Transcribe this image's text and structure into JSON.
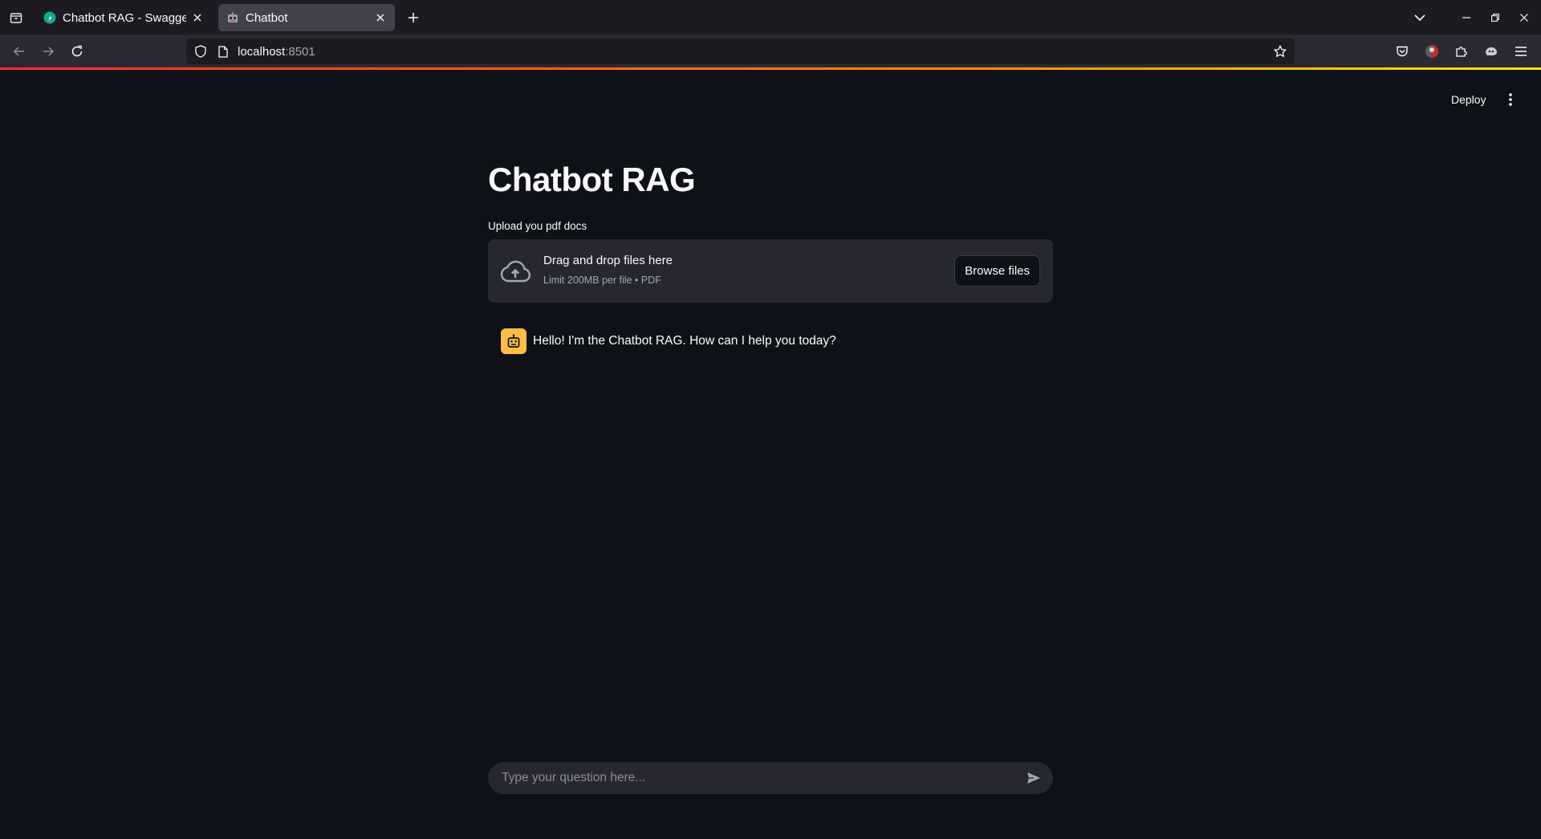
{
  "browser": {
    "tabs": [
      {
        "title": "Chatbot RAG - Swagger UI",
        "active": false,
        "favicon": "swagger-icon"
      },
      {
        "title": "Chatbot",
        "active": true,
        "favicon": "robot-emoji-icon"
      }
    ],
    "url": {
      "host": "localhost",
      "port": ":8501"
    }
  },
  "app": {
    "deploy_label": "Deploy",
    "title": "Chatbot RAG",
    "uploader": {
      "label": "Upload you pdf docs",
      "drop_text": "Drag and drop files here",
      "limit_text": "Limit 200MB per file • PDF",
      "browse_label": "Browse files"
    },
    "messages": [
      {
        "role": "assistant",
        "avatar": "robot-icon",
        "text": "Hello! I'm the Chatbot RAG. How can I help you today?"
      }
    ],
    "chat_input": {
      "placeholder": "Type your question here..."
    }
  },
  "colors": {
    "app_bg": "#0e1117",
    "widget_bg": "#262730",
    "avatar_bg": "#ffbd45",
    "loading_bar": [
      "#ff2b2b",
      "#ff8700",
      "#ffe312"
    ]
  }
}
